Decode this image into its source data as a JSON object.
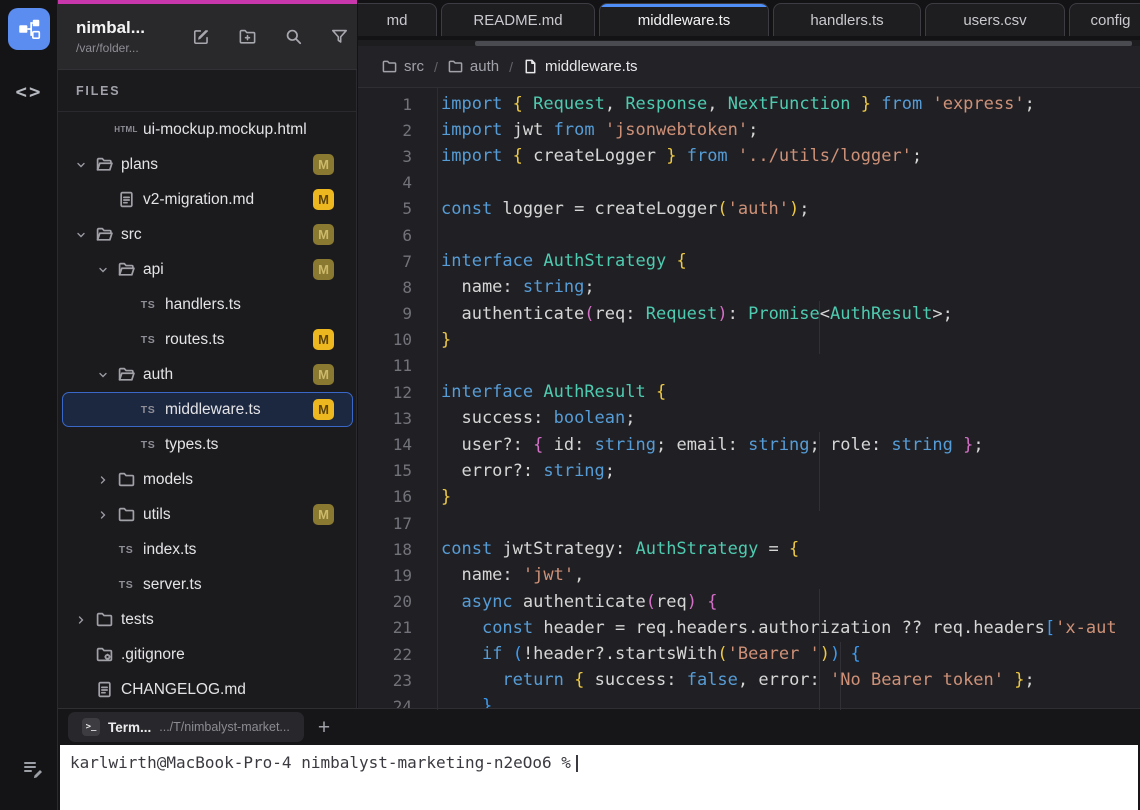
{
  "app": {
    "accent_pink": "#c837ab",
    "logo_blue": "#5b8df0",
    "active_tab_blue": "#4f8ff7"
  },
  "sidebar": {
    "title": "nimbal...",
    "subtitle": "/var/folder...",
    "section_label": "FILES",
    "header_icons": [
      {
        "name": "compose-icon"
      },
      {
        "name": "new-folder-icon"
      },
      {
        "name": "search-icon"
      },
      {
        "name": "filter-icon"
      }
    ],
    "tree": [
      {
        "label": "ui-mockup.mockup.html",
        "kind": "file-html",
        "level": 2,
        "chevron": "none",
        "badge": "none",
        "selected": false
      },
      {
        "label": "plans",
        "kind": "folder-open",
        "level": 1,
        "chevron": "down",
        "badge": "dim",
        "selected": false
      },
      {
        "label": "v2-migration.md",
        "kind": "file-md",
        "level": 2,
        "chevron": "none",
        "badge": "bright",
        "selected": false
      },
      {
        "label": "src",
        "kind": "folder-open",
        "level": 1,
        "chevron": "down",
        "badge": "dim",
        "selected": false
      },
      {
        "label": "api",
        "kind": "folder-open",
        "level": 2,
        "chevron": "down",
        "badge": "dim",
        "selected": false
      },
      {
        "label": "handlers.ts",
        "kind": "file-ts",
        "level": 3,
        "chevron": "none",
        "badge": "none",
        "selected": false
      },
      {
        "label": "routes.ts",
        "kind": "file-ts",
        "level": 3,
        "chevron": "none",
        "badge": "bright",
        "selected": false
      },
      {
        "label": "auth",
        "kind": "folder-open",
        "level": 2,
        "chevron": "down",
        "badge": "dim",
        "selected": false
      },
      {
        "label": "middleware.ts",
        "kind": "file-ts",
        "level": 3,
        "chevron": "none",
        "badge": "bright",
        "selected": true
      },
      {
        "label": "types.ts",
        "kind": "file-ts",
        "level": 3,
        "chevron": "none",
        "badge": "none",
        "selected": false
      },
      {
        "label": "models",
        "kind": "folder-closed",
        "level": 2,
        "chevron": "right",
        "badge": "none",
        "selected": false
      },
      {
        "label": "utils",
        "kind": "folder-closed",
        "level": 2,
        "chevron": "right",
        "badge": "dim",
        "selected": false
      },
      {
        "label": "index.ts",
        "kind": "file-ts",
        "level": 2,
        "chevron": "none",
        "badge": "none",
        "selected": false
      },
      {
        "label": "server.ts",
        "kind": "file-ts",
        "level": 2,
        "chevron": "none",
        "badge": "none",
        "selected": false
      },
      {
        "label": "tests",
        "kind": "folder-closed",
        "level": 1,
        "chevron": "right",
        "badge": "none",
        "selected": false
      },
      {
        "label": ".gitignore",
        "kind": "file-git",
        "level": 1,
        "chevron": "none",
        "badge": "none",
        "selected": false
      },
      {
        "label": "CHANGELOG.md",
        "kind": "file-doc",
        "level": 1,
        "chevron": "none",
        "badge": "none",
        "selected": false
      }
    ],
    "badge_letter": "M"
  },
  "tabs": [
    {
      "label": "md",
      "active": false,
      "cut": "left"
    },
    {
      "label": "README.md",
      "active": false,
      "cut": "none"
    },
    {
      "label": "middleware.ts",
      "active": true,
      "cut": "none"
    },
    {
      "label": "handlers.ts",
      "active": false,
      "cut": "none"
    },
    {
      "label": "users.csv",
      "active": false,
      "cut": "none"
    },
    {
      "label": "config",
      "active": false,
      "cut": "right"
    }
  ],
  "breadcrumb": [
    {
      "label": "src",
      "icon": "folder",
      "current": false
    },
    {
      "label": "auth",
      "icon": "folder",
      "current": false
    },
    {
      "label": "middleware.ts",
      "icon": "file",
      "current": true
    }
  ],
  "editor": {
    "lines": [
      {
        "n": 1,
        "tokens": [
          [
            "k",
            "import"
          ],
          [
            "w",
            " "
          ],
          [
            "y",
            "{"
          ],
          [
            "w",
            " "
          ],
          [
            "t",
            "Request"
          ],
          [
            "w",
            ", "
          ],
          [
            "t",
            "Response"
          ],
          [
            "w",
            ", "
          ],
          [
            "t",
            "NextFunction"
          ],
          [
            "w",
            " "
          ],
          [
            "y",
            "}"
          ],
          [
            "w",
            " "
          ],
          [
            "k",
            "from"
          ],
          [
            "w",
            " "
          ],
          [
            "s",
            "'express'"
          ],
          [
            "w",
            ";"
          ]
        ]
      },
      {
        "n": 2,
        "tokens": [
          [
            "k",
            "import"
          ],
          [
            "w",
            " jwt "
          ],
          [
            "k",
            "from"
          ],
          [
            "w",
            " "
          ],
          [
            "s",
            "'jsonwebtoken'"
          ],
          [
            "w",
            ";"
          ]
        ]
      },
      {
        "n": 3,
        "tokens": [
          [
            "k",
            "import"
          ],
          [
            "w",
            " "
          ],
          [
            "y",
            "{"
          ],
          [
            "w",
            " createLogger "
          ],
          [
            "y",
            "}"
          ],
          [
            "w",
            " "
          ],
          [
            "k",
            "from"
          ],
          [
            "w",
            " "
          ],
          [
            "s",
            "'../utils/logger'"
          ],
          [
            "w",
            ";"
          ]
        ]
      },
      {
        "n": 4,
        "tokens": []
      },
      {
        "n": 5,
        "tokens": [
          [
            "k",
            "const"
          ],
          [
            "w",
            " logger = createLogger"
          ],
          [
            "y",
            "("
          ],
          [
            "s",
            "'auth'"
          ],
          [
            "y",
            ")"
          ],
          [
            "w",
            ";"
          ]
        ]
      },
      {
        "n": 6,
        "tokens": []
      },
      {
        "n": 7,
        "tokens": [
          [
            "k",
            "interface"
          ],
          [
            "w",
            " "
          ],
          [
            "t",
            "AuthStrategy"
          ],
          [
            "w",
            " "
          ],
          [
            "y",
            "{"
          ]
        ]
      },
      {
        "n": 8,
        "tokens": [
          [
            "w",
            "  name: "
          ],
          [
            "k",
            "string"
          ],
          [
            "w",
            ";"
          ]
        ]
      },
      {
        "n": 9,
        "tokens": [
          [
            "w",
            "  authenticate"
          ],
          [
            "p",
            "("
          ],
          [
            "w",
            "req: "
          ],
          [
            "t",
            "Request"
          ],
          [
            "p",
            ")"
          ],
          [
            "w",
            ": "
          ],
          [
            "t",
            "Promise"
          ],
          [
            "w",
            "<"
          ],
          [
            "t",
            "AuthResult"
          ],
          [
            "w",
            ">;"
          ]
        ]
      },
      {
        "n": 10,
        "tokens": [
          [
            "y",
            "}"
          ]
        ]
      },
      {
        "n": 11,
        "tokens": []
      },
      {
        "n": 12,
        "tokens": [
          [
            "k",
            "interface"
          ],
          [
            "w",
            " "
          ],
          [
            "t",
            "AuthResult"
          ],
          [
            "w",
            " "
          ],
          [
            "y",
            "{"
          ]
        ]
      },
      {
        "n": 13,
        "tokens": [
          [
            "w",
            "  success: "
          ],
          [
            "k",
            "boolean"
          ],
          [
            "w",
            ";"
          ]
        ]
      },
      {
        "n": 14,
        "tokens": [
          [
            "w",
            "  user?: "
          ],
          [
            "p",
            "{"
          ],
          [
            "w",
            " id: "
          ],
          [
            "k",
            "string"
          ],
          [
            "w",
            "; email: "
          ],
          [
            "k",
            "string"
          ],
          [
            "w",
            "; role: "
          ],
          [
            "k",
            "string"
          ],
          [
            "w",
            " "
          ],
          [
            "p",
            "}"
          ],
          [
            "w",
            ";"
          ]
        ]
      },
      {
        "n": 15,
        "tokens": [
          [
            "w",
            "  error?: "
          ],
          [
            "k",
            "string"
          ],
          [
            "w",
            ";"
          ]
        ]
      },
      {
        "n": 16,
        "tokens": [
          [
            "y",
            "}"
          ]
        ]
      },
      {
        "n": 17,
        "tokens": []
      },
      {
        "n": 18,
        "tokens": [
          [
            "k",
            "const"
          ],
          [
            "w",
            " jwtStrategy: "
          ],
          [
            "t",
            "AuthStrategy"
          ],
          [
            "w",
            " = "
          ],
          [
            "y",
            "{"
          ]
        ]
      },
      {
        "n": 19,
        "tokens": [
          [
            "w",
            "  name: "
          ],
          [
            "s",
            "'jwt'"
          ],
          [
            "w",
            ","
          ]
        ]
      },
      {
        "n": 20,
        "tokens": [
          [
            "w",
            "  "
          ],
          [
            "k",
            "async"
          ],
          [
            "w",
            " authenticate"
          ],
          [
            "p",
            "("
          ],
          [
            "w",
            "req"
          ],
          [
            "p",
            ")"
          ],
          [
            "w",
            " "
          ],
          [
            "p",
            "{"
          ]
        ]
      },
      {
        "n": 21,
        "tokens": [
          [
            "w",
            "    "
          ],
          [
            "k",
            "const"
          ],
          [
            "w",
            " header = req.headers.authorization ?? req.headers"
          ],
          [
            "b",
            "["
          ],
          [
            "s",
            "'x-aut"
          ]
        ]
      },
      {
        "n": 22,
        "tokens": [
          [
            "w",
            "    "
          ],
          [
            "k",
            "if"
          ],
          [
            "w",
            " "
          ],
          [
            "b",
            "("
          ],
          [
            "w",
            "!header?.startsWith"
          ],
          [
            "y",
            "("
          ],
          [
            "s",
            "'Bearer '"
          ],
          [
            "y",
            ")"
          ],
          [
            "b",
            ")"
          ],
          [
            "w",
            " "
          ],
          [
            "b",
            "{"
          ]
        ]
      },
      {
        "n": 23,
        "tokens": [
          [
            "w",
            "      "
          ],
          [
            "k",
            "return"
          ],
          [
            "w",
            " "
          ],
          [
            "y",
            "{"
          ],
          [
            "w",
            " success: "
          ],
          [
            "k",
            "false"
          ],
          [
            "w",
            ", error: "
          ],
          [
            "s",
            "'No Bearer token'"
          ],
          [
            "w",
            " "
          ],
          [
            "y",
            "}"
          ],
          [
            "w",
            ";"
          ]
        ]
      },
      {
        "n": 24,
        "tokens": [
          [
            "w",
            "    "
          ],
          [
            "b",
            "}"
          ]
        ]
      }
    ]
  },
  "terminal": {
    "tab_label": "Term...",
    "tab_path": ".../T/nimbalyst-market...",
    "new_tab_label": "+",
    "prompt": "karlwirth@MacBook-Pro-4 nimbalyst-marketing-n2eOo6 %"
  }
}
